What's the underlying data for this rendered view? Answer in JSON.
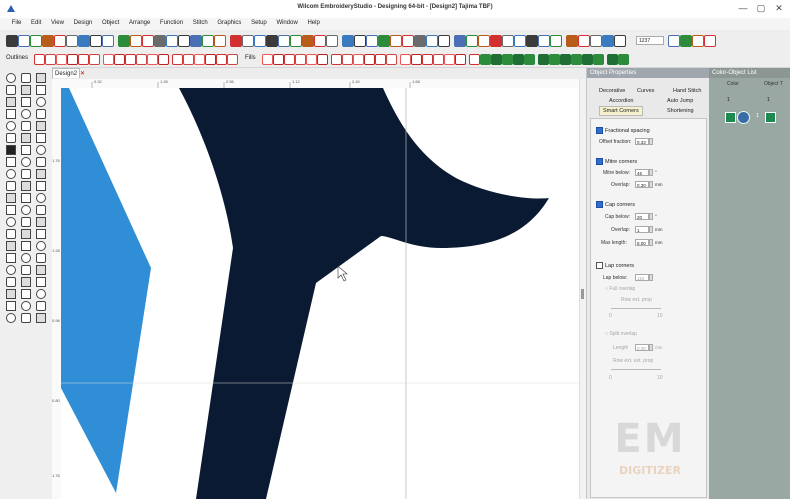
{
  "window": {
    "title": "Wilcom EmbroideryStudio - Designing 64-bit - [Design2]    Tajima TBF)",
    "minimize": "—",
    "maximize": "▢",
    "close": "✕"
  },
  "menu": [
    "File",
    "Edit",
    "View",
    "Design",
    "Object",
    "Arrange",
    "Function",
    "Stitch",
    "Graphics",
    "Setup",
    "Window",
    "Help"
  ],
  "toolbar1": {
    "zoom_value": "1237",
    "icon_colors": [
      "#3b3b3b",
      "#4a6fb5",
      "#2c8c3c",
      "#b85c1c",
      "#d23030",
      "#6b6b6b",
      "#3a7abf"
    ]
  },
  "toolbar2": {
    "outlines_label": "Outlines",
    "fills_label": "Fills"
  },
  "document": {
    "tab_label": "Design2",
    "tab_close": "✕"
  },
  "ruler": {
    "top_labels": [
      "0.32",
      "1.28",
      "2.56",
      "1.12",
      "2.40",
      "1.68"
    ],
    "left_labels": [
      "1.76",
      "1.28",
      "0.96",
      "0.80",
      "1.76"
    ]
  },
  "object_properties": {
    "title": "Object Properties",
    "tabs": {
      "decorative": "Decorative",
      "curves": "Curves",
      "hand_stitch": "Hand Stitch",
      "accordion": "Accordion",
      "auto_jump": "Auto Jump",
      "smart_corners": "Smart Corners",
      "shortening": "Shortening"
    },
    "fractional_spacing": {
      "label": "Fractional spacing",
      "checked": true,
      "offset_label": "Offset fraction:",
      "offset_value": "0.33"
    },
    "miter_corners": {
      "label": "Mitre corners",
      "checked": true,
      "mitre_below_label": "Mitre below:",
      "mitre_below_value": "45",
      "mitre_unit": "°",
      "overlap_label": "Overlap:",
      "overlap_value": "0.30",
      "overlap_unit": "mm"
    },
    "cap_corners": {
      "label": "Cap corners",
      "checked": true,
      "cap_below_label": "Cap below:",
      "cap_below_value": "20",
      "cap_unit": "°",
      "overlap_label": "Overlap:",
      "overlap_value": "1",
      "overlap_unit": "mm",
      "max_length_label": "Max length:",
      "max_length_value": "8.00",
      "max_length_unit": "mm"
    },
    "lap_corners": {
      "label": "Lap corners",
      "checked": false,
      "lap_below_label": "Lap below:",
      "lap_below_value": "110",
      "full_overlap_label": "Full overlap",
      "row_label": "Row ext. prop",
      "split_overlap_label": "Split overlap",
      "length_label": "Length",
      "length_value": "0.30",
      "length_unit": "mm",
      "row_ext_label": "Row ext. ext. prop",
      "slider_min": "0",
      "slider_max": "10"
    }
  },
  "color_list": {
    "title": "Color-Object List",
    "col_labels": [
      "Color",
      "Object T"
    ],
    "row_number": "1",
    "swatch_color": "#1d8a4f"
  },
  "watermark": {
    "em": "EM",
    "digitizer": "DIGITIZER"
  },
  "colors": {
    "navy": "#0b1a33",
    "blue": "#2f8ed6",
    "accent": "#2d6ed6"
  }
}
